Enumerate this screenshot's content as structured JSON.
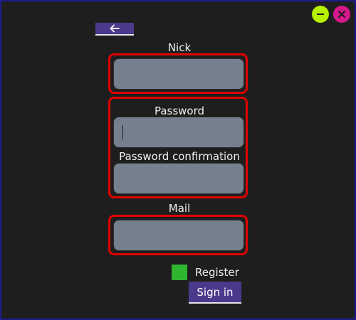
{
  "window": {
    "controls": {
      "minimize_icon": "minus-icon",
      "close_icon": "x-icon",
      "minimize_color": "#b4f000",
      "close_color": "#d6198a"
    }
  },
  "nav": {
    "back_icon": "arrow-left-icon"
  },
  "form": {
    "nick": {
      "label": "Nick",
      "value": ""
    },
    "password": {
      "label": "Password",
      "value": ""
    },
    "password_confirmation": {
      "label": "Password confirmation",
      "value": ""
    },
    "mail": {
      "label": "Mail",
      "value": ""
    },
    "register": {
      "label": "Register",
      "checked": true,
      "color": "#2fb52f"
    },
    "signin_label": "Sign in"
  },
  "colors": {
    "background": "#1e1e1e",
    "accent": "#4b3a8c",
    "group_border": "#e00000",
    "field_fill": "#75808e"
  }
}
